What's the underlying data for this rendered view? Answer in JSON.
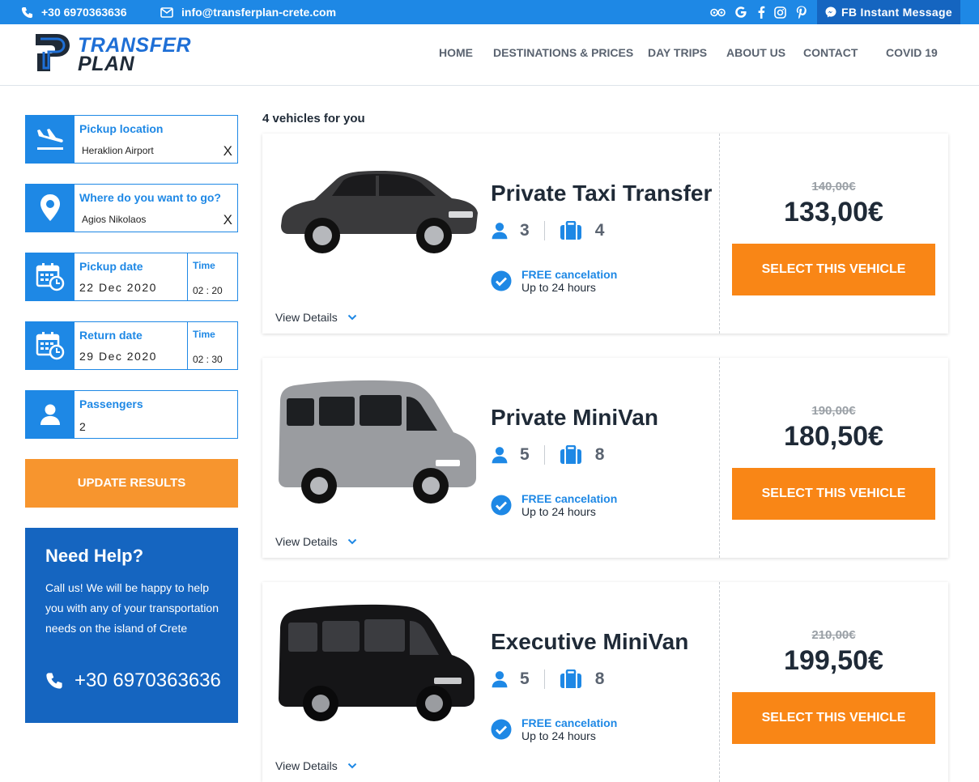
{
  "topbar": {
    "phone": "+30 6970363636",
    "email": "info@transferplan-crete.com",
    "fb_button": "FB Instant Message",
    "social_icons": [
      "tripadvisor-icon",
      "google-icon",
      "facebook-icon",
      "instagram-icon",
      "pinterest-icon"
    ]
  },
  "logo": {
    "line1": "TRANSFER",
    "line2": "PLAN"
  },
  "nav": [
    "HOME",
    "DESTINATIONS & PRICES",
    "DAY TRIPS",
    "ABOUT US",
    "CONTACT",
    "COVID 19"
  ],
  "search": {
    "pickup": {
      "label": "Pickup location",
      "value": "Heraklion Airport",
      "clear": "X"
    },
    "destination": {
      "label": "Where do you want to go?",
      "value": "Agios Nikolaos",
      "clear": "X"
    },
    "pickup_date": {
      "label": "Pickup date",
      "value": "22 Dec 2020",
      "time_label": "Time",
      "time_value": "02 : 20"
    },
    "return_date": {
      "label": "Return date",
      "value": "29 Dec 2020",
      "time_label": "Time",
      "time_value": "02 : 30"
    },
    "passengers": {
      "label": "Passengers",
      "value": "2"
    },
    "update_button": "UPDATE RESULTS"
  },
  "help": {
    "title": "Need Help?",
    "text": "Call us! We will be happy to help you with any of your transportation needs on the island of Crete",
    "phone": "+30 6970363636"
  },
  "results_count": "4 vehicles for you",
  "vehicles": [
    {
      "name": "Private Taxi Transfer",
      "passengers": "3",
      "luggage": "4",
      "free_cancel": "FREE cancelation",
      "cancel_window": "Up to 24 hours",
      "details": "View Details",
      "old_price": "140,00€",
      "price": "133,00€",
      "select": "SELECT THIS VEHICLE",
      "color": "#3a3a3c"
    },
    {
      "name": "Private MiniVan",
      "passengers": "5",
      "luggage": "8",
      "free_cancel": "FREE cancelation",
      "cancel_window": "Up to 24 hours",
      "details": "View Details",
      "old_price": "190,00€",
      "price": "180,50€",
      "select": "SELECT THIS VEHICLE",
      "color": "#9a9ca0"
    },
    {
      "name": "Executive MiniVan",
      "passengers": "5",
      "luggage": "8",
      "free_cancel": "FREE cancelation",
      "cancel_window": "Up to 24 hours",
      "details": "View Details",
      "old_price": "210,00€",
      "price": "199,50€",
      "select": "SELECT THIS VEHICLE",
      "color": "#151517"
    }
  ],
  "colors": {
    "primary": "#1e88e5",
    "dark_blue": "#1565c0",
    "orange": "#f98616",
    "update_orange": "#f7952e"
  }
}
